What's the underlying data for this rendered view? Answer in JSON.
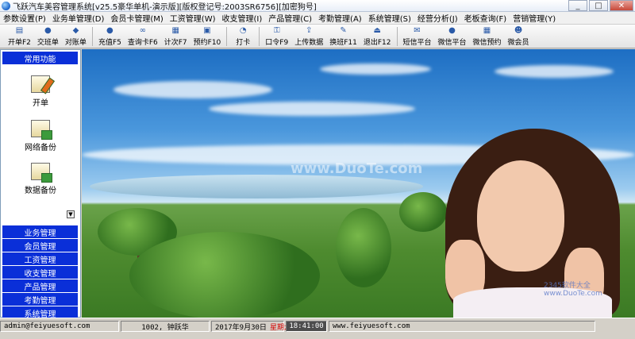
{
  "window": {
    "title": "飞跃汽车美容管理系统[v25.5豪华单机-演示版][版权登记号:2003SR6756][加密狗号]",
    "buttons": {
      "minimize": "_",
      "maximize": "□",
      "close": "✕"
    }
  },
  "menu": [
    "参数设置(P)",
    "业务单管理(D)",
    "会员卡管理(M)",
    "工资管理(W)",
    "收支管理(I)",
    "产品管理(C)",
    "考勤管理(A)",
    "系统管理(S)",
    "经营分析(J)",
    "老板查询(F)",
    "营销管理(Y)"
  ],
  "toolbar": [
    {
      "label": "开单F2",
      "icon": "open-order-icon"
    },
    {
      "label": "交班单",
      "icon": "handover-icon"
    },
    {
      "label": "对账单",
      "icon": "statement-icon"
    },
    {
      "label": "充值F5",
      "icon": "recharge-icon"
    },
    {
      "label": "查询卡F6",
      "icon": "card-query-icon"
    },
    {
      "label": "计次F7",
      "icon": "count-icon"
    },
    {
      "label": "预约F10",
      "icon": "appointment-icon"
    },
    {
      "label": "打卡",
      "icon": "clock-icon"
    },
    {
      "label": "口令F9",
      "icon": "key-icon"
    },
    {
      "label": "上传数据",
      "icon": "upload-icon"
    },
    {
      "label": "换班F11",
      "icon": "shift-change-icon"
    },
    {
      "label": "退出F12",
      "icon": "exit-icon"
    },
    {
      "label": "短信平台",
      "icon": "sms-icon"
    },
    {
      "label": "微信平台",
      "icon": "wechat-icon"
    },
    {
      "label": "微信预约",
      "icon": "wechat-appointment-icon"
    },
    {
      "label": "微会员",
      "icon": "micro-member-icon"
    }
  ],
  "left_panel": {
    "header": "常用功能",
    "functions": [
      {
        "label": "开单",
        "icon": "open-order-icon"
      },
      {
        "label": "网络备份",
        "icon": "network-backup-icon"
      },
      {
        "label": "数据备份",
        "icon": "data-backup-icon"
      }
    ],
    "nav": [
      "业务管理",
      "会员管理",
      "工资管理",
      "收支管理",
      "产品管理",
      "考勤管理",
      "系统管理"
    ]
  },
  "main": {
    "watermark": "www.DuoTe.com",
    "watermark2": "2345软件大全 www.DuoTe.com"
  },
  "status": {
    "user": "admin@feiyuesoft.com",
    "operator": "1002, 钟跃华",
    "date": "2017年9月30日",
    "weekday": "星期六",
    "time": "18:41:00",
    "website": "www.feiyuesoft.com"
  }
}
